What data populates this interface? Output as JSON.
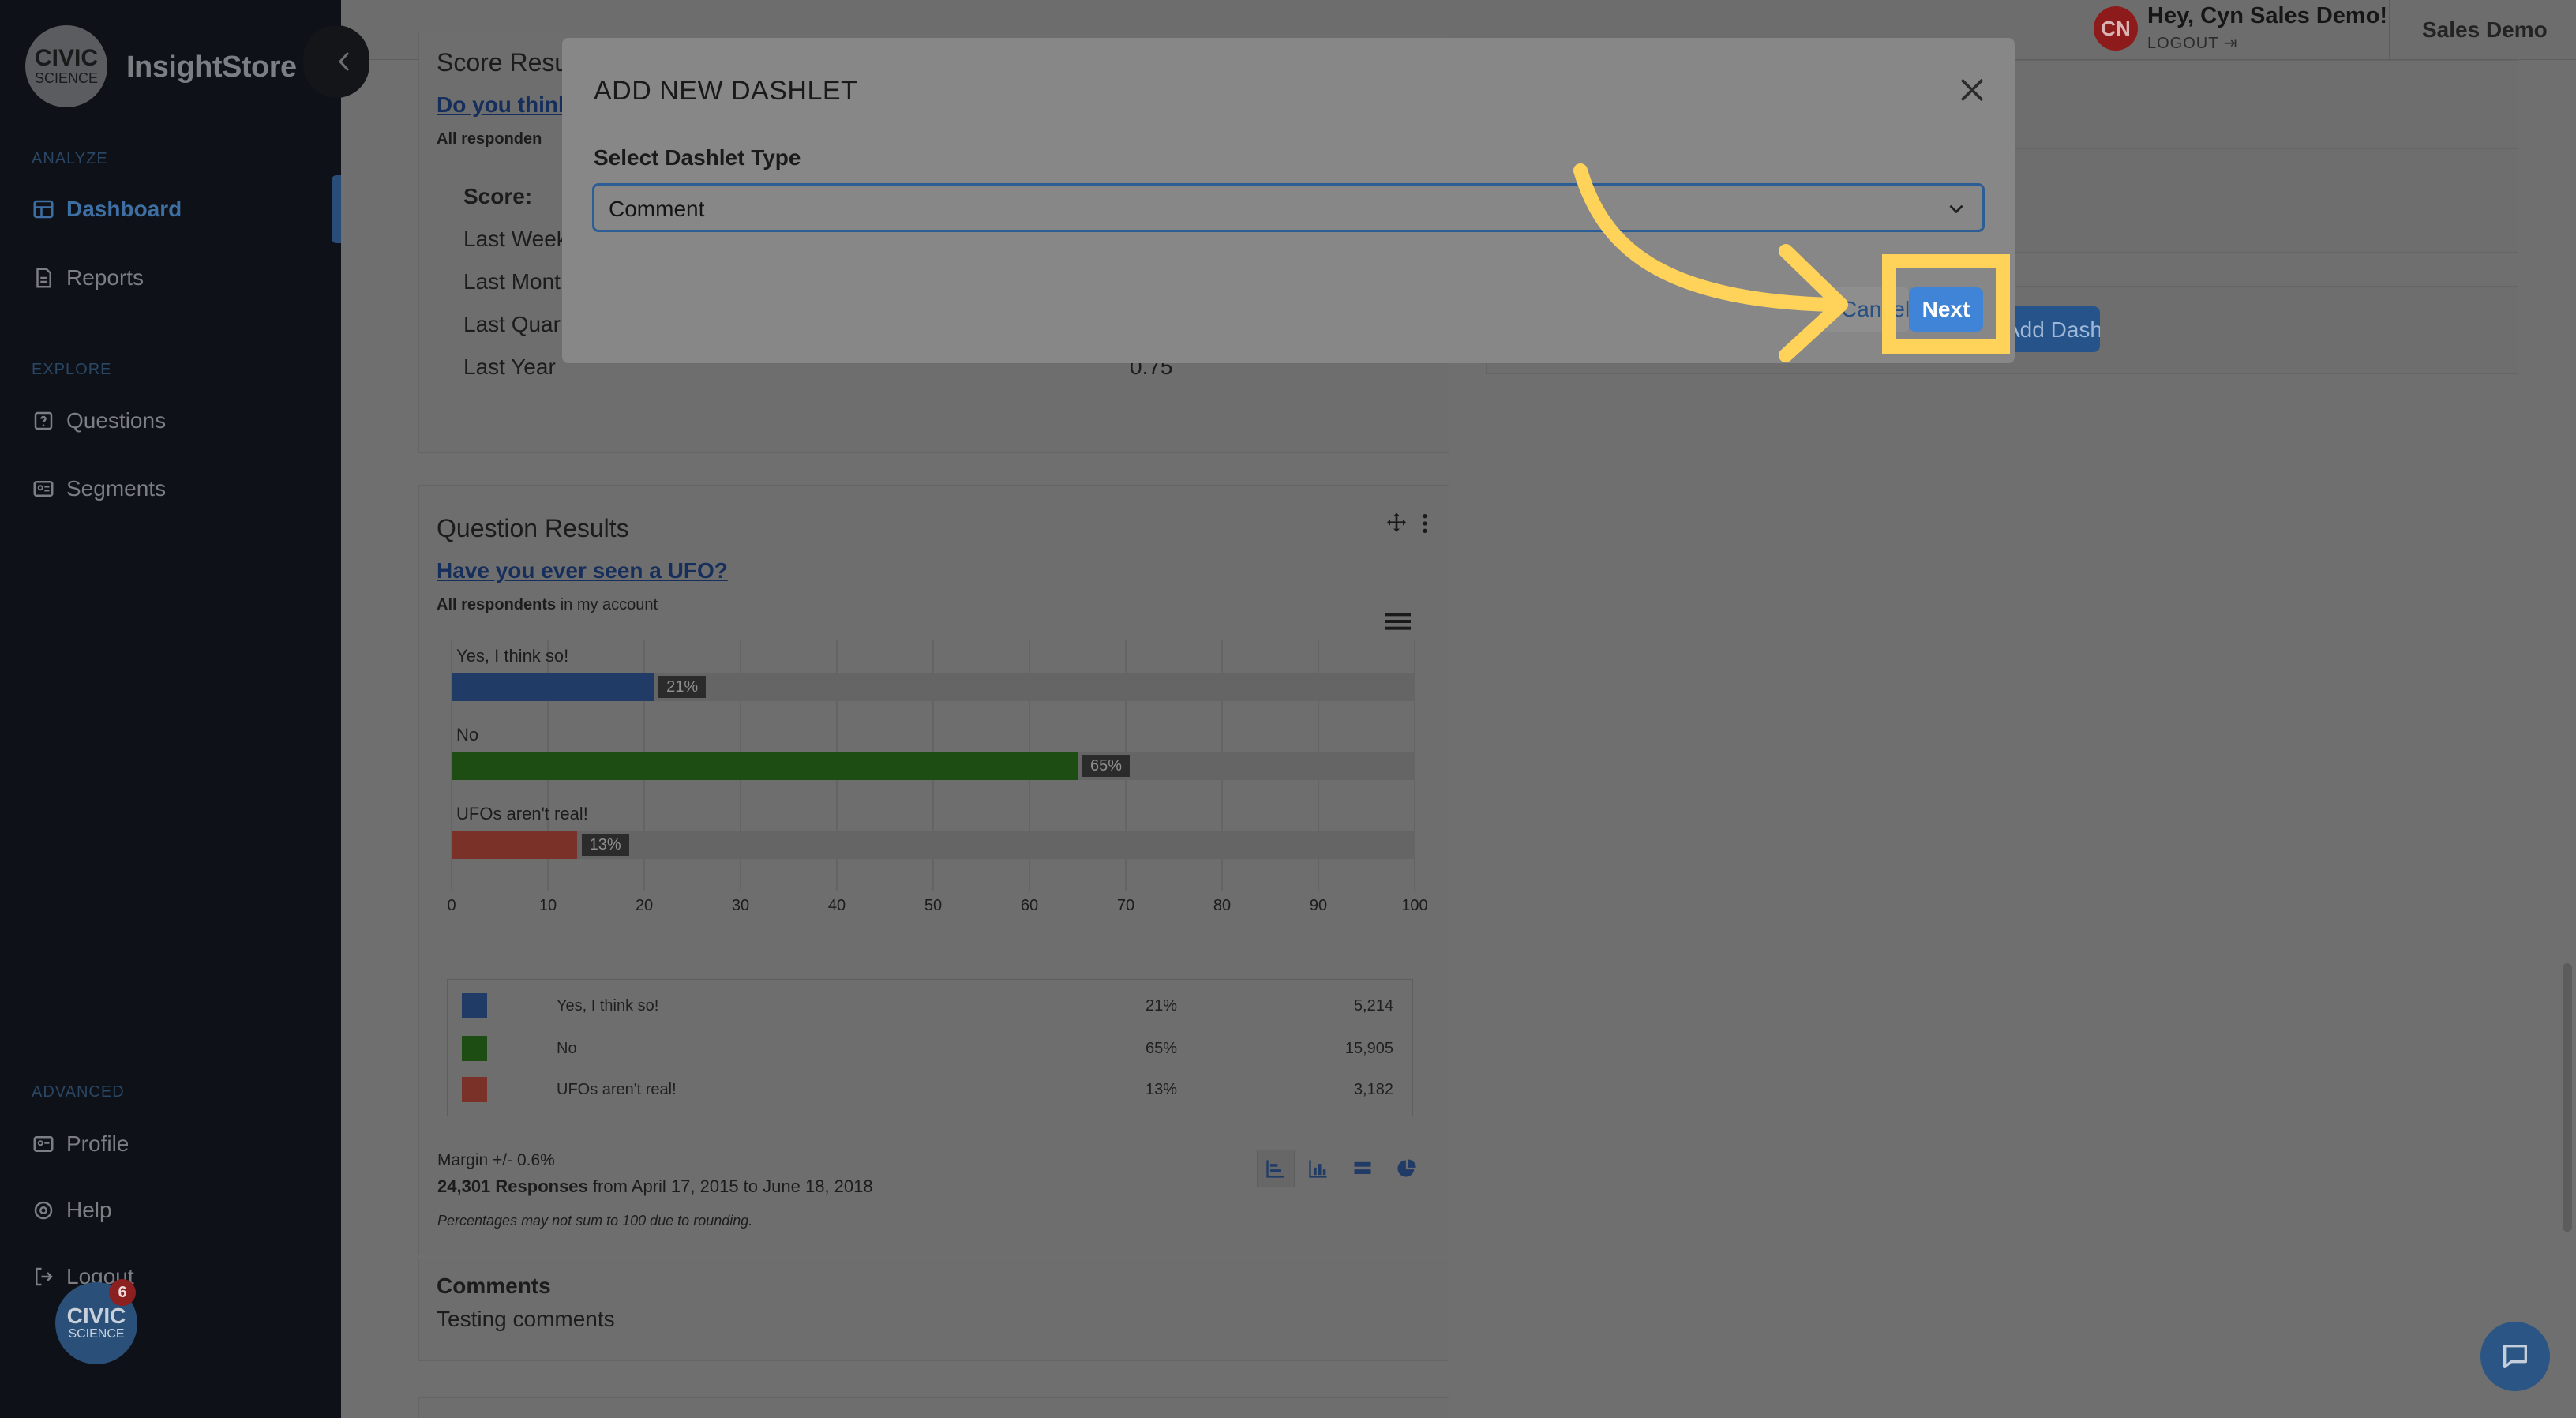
{
  "brand": {
    "logo_line1": "CIVIC",
    "logo_line2": "SCIENCE",
    "app_name": "InsightStore"
  },
  "sidebar": {
    "sections": [
      {
        "label": "ANALYZE"
      },
      {
        "label": "EXPLORE"
      },
      {
        "label": "ADVANCED"
      }
    ],
    "items": [
      {
        "label": "Dashboard",
        "icon": "dashboard-icon",
        "active": true
      },
      {
        "label": "Reports",
        "icon": "document-icon"
      },
      {
        "label": "Questions",
        "icon": "question-icon"
      },
      {
        "label": "Segments",
        "icon": "segments-icon"
      },
      {
        "label": "Profile",
        "icon": "id-card-icon"
      },
      {
        "label": "Help",
        "icon": "lifebuoy-icon"
      },
      {
        "label": "Logout",
        "icon": "logout-icon"
      }
    ],
    "badge": {
      "line1": "CIVIC",
      "line2": "SCIENCE",
      "count": "6"
    }
  },
  "topbar": {
    "avatar_initials": "CN",
    "greeting": "Hey, Cyn Sales Demo!",
    "logout": "LOGOUT",
    "account": "Sales Demo"
  },
  "score_card": {
    "title": "Score Resu",
    "question_link": "Do you think",
    "respondents": "All responden",
    "score_label": "Score:",
    "rows": [
      "Last Week",
      "Last Mont",
      "Last Quar",
      "Last Year"
    ],
    "last_value": "0.75"
  },
  "question_card": {
    "title": "Question Results",
    "question_link": "Have you ever seen a UFO?",
    "respondents_bold": "All respondents",
    "respondents_rest": "in my account",
    "margin": "Margin +/- 0.6%",
    "responses_bold": "24,301 Responses",
    "responses_rest": "from April 17, 2015 to June 18, 2018",
    "footnote": "Percentages may not sum to 100 due to rounding."
  },
  "chart_data": {
    "type": "bar",
    "orientation": "horizontal",
    "categories": [
      "Yes, I think so!",
      "No",
      "UFOs aren't real!"
    ],
    "values": [
      21,
      65,
      13
    ],
    "value_labels": [
      "21%",
      "65%",
      "13%"
    ],
    "counts": [
      "5,214",
      "15,905",
      "3,182"
    ],
    "colors": [
      "#1f3b66",
      "#1d4d13",
      "#7a3127"
    ],
    "xlim": [
      0,
      100
    ],
    "xticks": [
      "0",
      "10",
      "20",
      "30",
      "40",
      "50",
      "60",
      "70",
      "80",
      "90",
      "100"
    ],
    "grid": true
  },
  "comments_card": {
    "title": "Comments",
    "text": "Testing comments"
  },
  "modal": {
    "title": "ADD NEW DASHLET",
    "field_label": "Select Dashlet Type",
    "selected": "Comment",
    "cancel": "Cancel",
    "next": "Next"
  },
  "background_button": "Add Dashlet",
  "colors": {
    "highlight": "#ffd35a",
    "next": "#3f84d6",
    "accent": "#3e6fa3"
  }
}
